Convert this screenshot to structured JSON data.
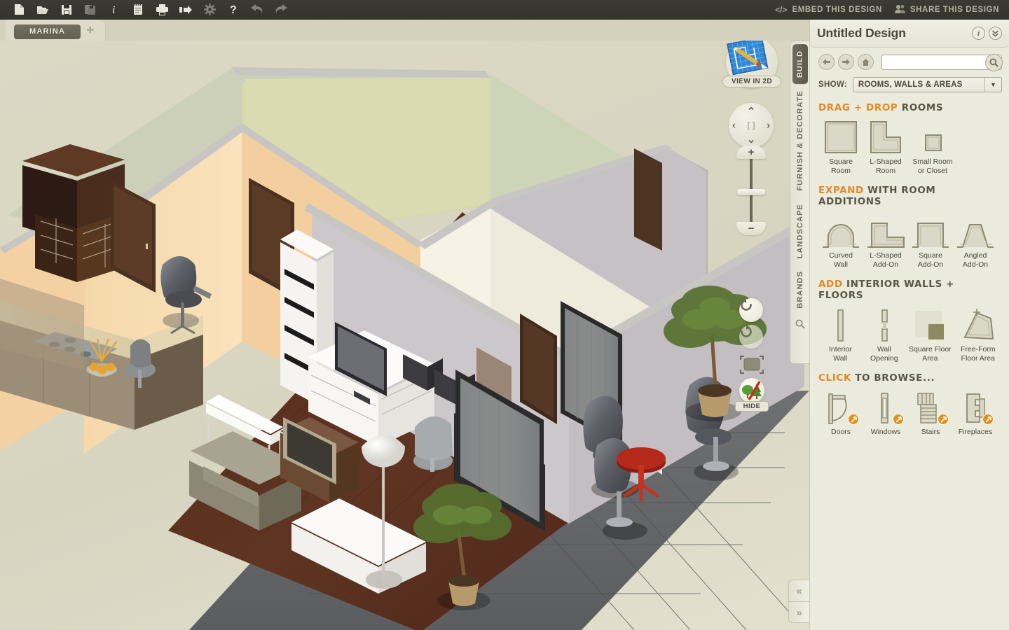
{
  "toolbar": {
    "icons": [
      {
        "name": "new-file-icon",
        "label": "New"
      },
      {
        "name": "open-folder-icon",
        "label": "Open"
      },
      {
        "name": "save-icon",
        "label": "Save"
      },
      {
        "name": "save-as-icon",
        "label": "Save As"
      },
      {
        "name": "info-icon",
        "label": "Info"
      },
      {
        "name": "notes-icon",
        "label": "Notes"
      },
      {
        "name": "print-icon",
        "label": "Print"
      },
      {
        "name": "export-icon",
        "label": "Export"
      },
      {
        "name": "settings-gear-icon",
        "label": "Settings"
      },
      {
        "name": "help-icon",
        "label": "Help"
      },
      {
        "name": "undo-icon",
        "label": "Undo"
      },
      {
        "name": "redo-icon",
        "label": "Redo"
      }
    ],
    "embed_label": "EMBED THIS DESIGN",
    "embed_glyph": "</>",
    "share_label": "SHARE THIS DESIGN"
  },
  "tabs": {
    "document_tab": "MARINA",
    "add_tab": "+"
  },
  "viewport": {
    "view_2d_label": "VIEW IN 2D",
    "hide_label": "HIDE",
    "dpad": {
      "up": "⌃",
      "down": "⌄",
      "left": "‹",
      "right": "›",
      "center": "[ ]"
    },
    "zoom": {
      "plus": "+",
      "minus": "−"
    }
  },
  "vertical_tabs": [
    {
      "label": "BUILD",
      "active": true
    },
    {
      "label": "FURNISH & DECORATE",
      "active": false
    },
    {
      "label": "LANDSCAPE",
      "active": false
    },
    {
      "label": "BRANDS",
      "active": false
    }
  ],
  "panel": {
    "title": "Untitled Design",
    "info_btn": "i",
    "collapse_btn": "»",
    "search_value": "",
    "search_placeholder": "",
    "show_label": "SHOW:",
    "show_value": "ROOMS, WALLS & AREAS",
    "sections": [
      {
        "id": "drag-drop-rooms",
        "head_accent": "DRAG + DROP",
        "head_rest": "ROOMS",
        "items": [
          {
            "name": "square-room",
            "caption": "Square\nRoom",
            "art": "square-room-icon",
            "badge": false
          },
          {
            "name": "l-shaped-room",
            "caption": "L-Shaped\nRoom",
            "art": "l-shaped-room-icon",
            "badge": false
          },
          {
            "name": "small-room-or-closet",
            "caption": "Small Room\nor Closet",
            "art": "small-room-icon",
            "badge": false
          }
        ]
      },
      {
        "id": "expand-room-additions",
        "head_accent": "EXPAND",
        "head_rest": "WITH ROOM ADDITIONS",
        "items": [
          {
            "name": "curved-wall",
            "caption": "Curved\nWall",
            "art": "curved-wall-icon",
            "badge": false
          },
          {
            "name": "l-shaped-add-on",
            "caption": "L-Shaped\nAdd-On",
            "art": "l-shaped-addon-icon",
            "badge": false
          },
          {
            "name": "square-add-on",
            "caption": "Square\nAdd-On",
            "art": "square-addon-icon",
            "badge": false
          },
          {
            "name": "angled-add-on",
            "caption": "Angled\nAdd-On",
            "art": "angled-addon-icon",
            "badge": false
          }
        ]
      },
      {
        "id": "add-interior-walls-floors",
        "head_accent": "ADD",
        "head_rest": "INTERIOR WALLS + FLOORS",
        "items": [
          {
            "name": "interior-wall",
            "caption": "Interior\nWall",
            "art": "interior-wall-icon",
            "badge": false
          },
          {
            "name": "wall-opening",
            "caption": "Wall\nOpening",
            "art": "wall-opening-icon",
            "badge": false
          },
          {
            "name": "square-floor-area",
            "caption": "Square Floor\nArea",
            "art": "square-floor-icon",
            "badge": false
          },
          {
            "name": "free-form-floor-area",
            "caption": "Free-Form\nFloor Area",
            "art": "freeform-floor-icon",
            "badge": false
          }
        ]
      },
      {
        "id": "click-to-browse",
        "head_accent": "CLICK",
        "head_rest": "TO BROWSE...",
        "items": [
          {
            "name": "doors",
            "caption": "Doors",
            "art": "door-icon",
            "badge": true
          },
          {
            "name": "windows",
            "caption": "Windows",
            "art": "window-icon",
            "badge": true
          },
          {
            "name": "stairs",
            "caption": "Stairs",
            "art": "stairs-icon",
            "badge": true
          },
          {
            "name": "fireplaces",
            "caption": "Fireplaces",
            "art": "fireplace-icon",
            "badge": true
          }
        ]
      }
    ]
  },
  "collapse": {
    "left": "«",
    "right": "»"
  },
  "colors": {
    "toolbar_bg": "#34332c",
    "panel_bg": "#EAEADD",
    "viewport_bg": "#D9D8C4",
    "accent_orange": "#E08A28",
    "active_tab": "#63604f",
    "text_dark": "#4b4739"
  }
}
